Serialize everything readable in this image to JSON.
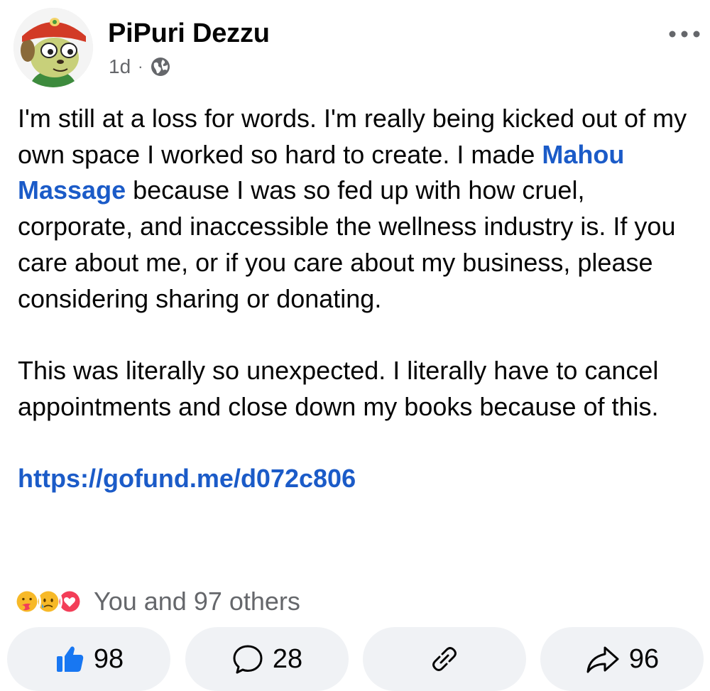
{
  "post": {
    "author": "PiPuri Dezzu",
    "time": "1d",
    "separator": "·",
    "privacy_icon": "globe-icon",
    "paragraph1_before": "I'm still at a loss for words. I'm really being kicked out of my own space I worked so hard to create. I made ",
    "paragraph1_link": "Mahou Massage",
    "paragraph1_after": " because I was so fed up with how cruel, corporate, and inaccessible the wellness industry is.  If you care about me, or if you care about my business, please considering sharing or donating.",
    "paragraph2": "This was literally so unexpected. I literally have to cancel appointments and close down my books because of this.",
    "url": "https://gofund.me/d072c806"
  },
  "reactions": {
    "icons": [
      "care-emoji",
      "sad-emoji",
      "love-emoji"
    ],
    "summary": "You and 97 others"
  },
  "actions": {
    "like_count": "98",
    "comment_count": "28",
    "share_count": "96"
  },
  "colors": {
    "link": "#1b5bc8",
    "like_blue": "#1877f2",
    "love_red": "#f33e58",
    "muted": "#65676b",
    "pill_bg": "#f0f2f5"
  }
}
